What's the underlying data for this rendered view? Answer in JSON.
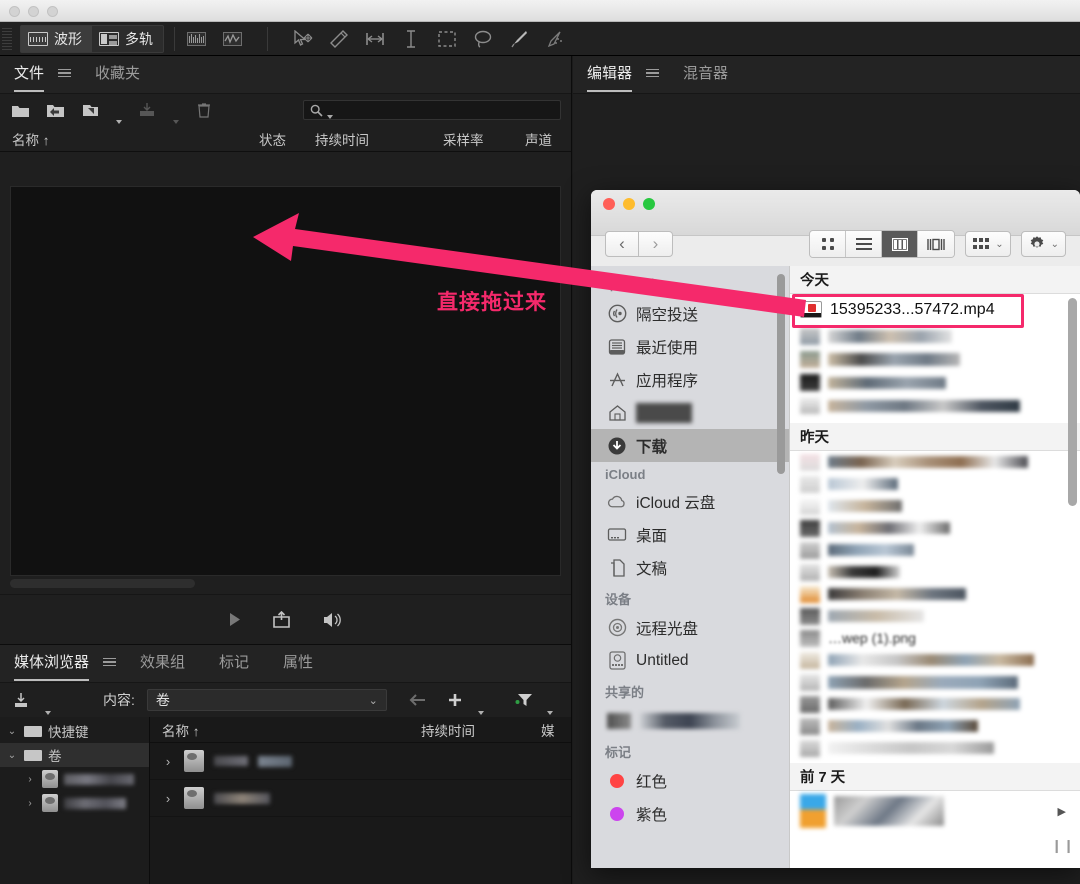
{
  "app": {
    "toolbar": {
      "modes": [
        {
          "label": "波形",
          "icon": "waveform-icon",
          "active": true
        },
        {
          "label": "多轨",
          "icon": "multitrack-icon",
          "active": false
        }
      ],
      "tools": [
        "spectral-frequency-icon",
        "spectral-pitch-icon",
        "move-tool-icon",
        "razor-tool-icon",
        "slip-tool-icon",
        "time-selection-icon",
        "marquee-selection-icon",
        "lasso-selection-icon",
        "paintbrush-selection-icon",
        "spot-healing-icon"
      ]
    },
    "files_panel": {
      "tabs": [
        {
          "label": "文件",
          "active": true
        },
        {
          "label": "收藏夹",
          "active": false
        }
      ],
      "menu_icon": "panel-menu-icon",
      "tools": [
        "open-file-icon",
        "import-file-icon",
        "new-file-icon",
        "save-icon",
        "delete-icon"
      ],
      "search": {
        "placeholder": "",
        "value": "",
        "icon": "search-icon"
      },
      "columns": [
        "名称 ↑",
        "状态",
        "持续时间",
        "采样率",
        "声道"
      ],
      "rows": [],
      "transport": [
        "play-icon",
        "insert-into-multitrack-icon",
        "auto-play-icon"
      ]
    },
    "media_panel": {
      "tabs": [
        {
          "label": "媒体浏览器",
          "active": true
        },
        {
          "label": "效果组",
          "active": false
        },
        {
          "label": "标记",
          "active": false
        },
        {
          "label": "属性",
          "active": false
        }
      ],
      "menu_icon": "panel-menu-icon",
      "import_icon": "import-icon",
      "content_label": "内容:",
      "content_value": "卷",
      "back_icon": "back-arrow-icon",
      "add_icon": "add-shortcut-icon",
      "filter_icon": "filter-icon",
      "tree": [
        {
          "label": "快捷键",
          "icon": "shortcut-icon",
          "expanded": true,
          "depth": 0,
          "selected": false
        },
        {
          "label": "卷",
          "icon": "volume-icon",
          "expanded": true,
          "depth": 0,
          "selected": true
        },
        {
          "label": "",
          "icon": "drive-icon",
          "expanded": false,
          "depth": 1,
          "selected": false,
          "redacted": true
        },
        {
          "label": "",
          "icon": "drive-icon",
          "expanded": false,
          "depth": 1,
          "selected": false,
          "redacted": true
        }
      ],
      "columns": [
        "名称 ↑",
        "持续时间",
        "媒"
      ],
      "items": [
        {
          "icon": "drive-icon",
          "redacted": true
        },
        {
          "icon": "drive-icon",
          "redacted": true
        }
      ]
    },
    "editor_panel": {
      "tabs": [
        {
          "label": "编辑器",
          "active": true
        },
        {
          "label": "混音器",
          "active": false
        }
      ],
      "menu_icon": "panel-menu-icon"
    }
  },
  "finder": {
    "traffic_lights": [
      {
        "name": "close",
        "color": "#ff5f57"
      },
      {
        "name": "minimize",
        "color": "#febc2e"
      },
      {
        "name": "zoom",
        "color": "#28c840"
      }
    ],
    "nav": {
      "back": "‹",
      "forward": "›"
    },
    "view_modes": [
      {
        "name": "icon-view",
        "active": false
      },
      {
        "name": "list-view",
        "active": false
      },
      {
        "name": "column-view",
        "active": true
      },
      {
        "name": "gallery-view",
        "active": false
      }
    ],
    "arrange_icon": "arrange-icon",
    "action_icon": "gear-icon",
    "sidebar": {
      "sections": [
        {
          "title": "个人收藏",
          "items": [
            {
              "label": "隔空投送",
              "icon": "airdrop-icon",
              "selected": false
            },
            {
              "label": "最近使用",
              "icon": "recents-icon",
              "selected": false
            },
            {
              "label": "应用程序",
              "icon": "applications-icon",
              "selected": false
            },
            {
              "label": "",
              "icon": "home-icon",
              "selected": false,
              "redacted": true
            },
            {
              "label": "下载",
              "icon": "downloads-icon",
              "selected": true
            }
          ]
        },
        {
          "title": "iCloud",
          "items": [
            {
              "label": "iCloud 云盘",
              "icon": "icloud-icon",
              "selected": false
            },
            {
              "label": "桌面",
              "icon": "desktop-icon",
              "selected": false
            },
            {
              "label": "文稿",
              "icon": "documents-icon",
              "selected": false
            }
          ]
        },
        {
          "title": "设备",
          "items": [
            {
              "label": "远程光盘",
              "icon": "remote-disc-icon",
              "selected": false
            },
            {
              "label": "Untitled",
              "icon": "disk-icon",
              "selected": false
            }
          ]
        },
        {
          "title": "共享的",
          "items": [
            {
              "label": "",
              "icon": "shared-computer-icon",
              "selected": false,
              "redacted": true
            }
          ]
        },
        {
          "title": "标记",
          "items": [
            {
              "label": "红色",
              "icon": "tag-dot-icon",
              "color": "#ff4444",
              "selected": false
            },
            {
              "label": "紫色",
              "icon": "tag-dot-icon",
              "color": "#cc44ee",
              "selected": false
            }
          ]
        }
      ]
    },
    "content": {
      "groups": [
        {
          "title": "今天",
          "files": [
            {
              "name": "15395233...57472.mp4",
              "icon": "mp4-file-icon",
              "highlighted": true
            },
            {
              "name": "",
              "redacted": true
            },
            {
              "name": "",
              "redacted": true
            },
            {
              "name": "",
              "redacted": true
            }
          ]
        },
        {
          "title": "昨天",
          "files": [
            {
              "name": "",
              "redacted": true
            },
            {
              "name": "",
              "redacted": true
            },
            {
              "name": "",
              "redacted": true
            },
            {
              "name": "",
              "redacted": true
            },
            {
              "name": "",
              "redacted": true
            },
            {
              "name": "",
              "redacted": true
            },
            {
              "name": "",
              "redacted": true
            },
            {
              "name": "",
              "redacted": true
            },
            {
              "name": "…wep (1).png",
              "redacted": true
            },
            {
              "name": "",
              "redacted": true
            },
            {
              "name": "",
              "redacted": true
            },
            {
              "name": "",
              "redacted": true
            },
            {
              "name": "",
              "redacted": true
            }
          ]
        },
        {
          "title": "前 7 天",
          "files": [
            {
              "name": "",
              "redacted": true
            }
          ]
        }
      ]
    }
  },
  "annotation": {
    "text": "直接拖过来",
    "arrow_color": "#f5296b",
    "text_color": "#f5296b",
    "outline_color": "#ffffff",
    "highlight_color": "#f5296b"
  }
}
